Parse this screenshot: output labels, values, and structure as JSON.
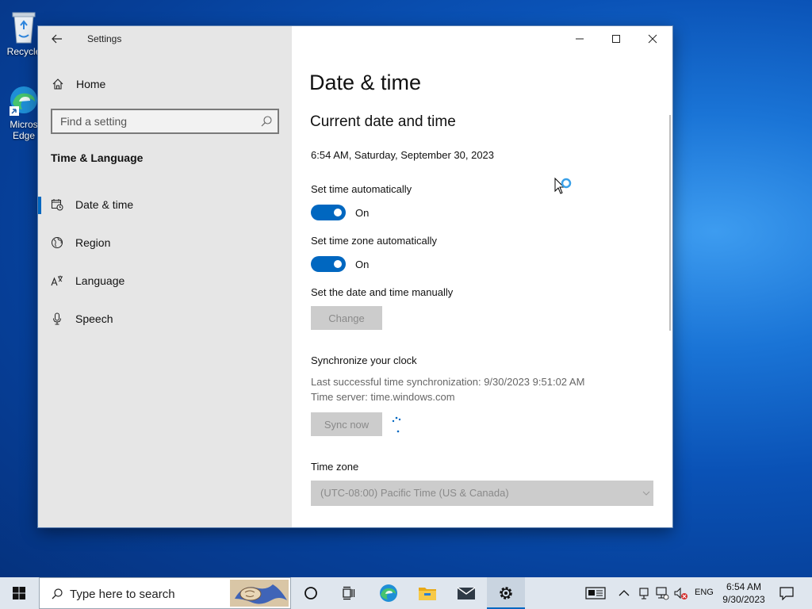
{
  "desktop": {
    "recycle_label": "Recycle",
    "edge_label_1": "Micros",
    "edge_label_2": "Edge"
  },
  "window": {
    "title": "Settings",
    "home_label": "Home",
    "search_placeholder": "Find a setting",
    "section_title": "Time & Language",
    "nav": [
      {
        "label": "Date & time",
        "icon": "calendar-clock-icon",
        "active": true
      },
      {
        "label": "Region",
        "icon": "globe-icon"
      },
      {
        "label": "Language",
        "icon": "language-icon"
      },
      {
        "label": "Speech",
        "icon": "microphone-icon"
      }
    ]
  },
  "content": {
    "page_title": "Date & time",
    "current_heading": "Current date and time",
    "current_datetime": "6:54 AM, Saturday, September 30, 2023",
    "set_time_auto_label": "Set time automatically",
    "set_time_auto_state": "On",
    "set_tz_auto_label": "Set time zone automatically",
    "set_tz_auto_state": "On",
    "manual_label": "Set the date and time manually",
    "change_button": "Change",
    "sync_heading": "Synchronize your clock",
    "last_sync": "Last successful time synchronization: 9/30/2023 9:51:02 AM",
    "time_server": "Time server: time.windows.com",
    "sync_button": "Sync now",
    "timezone_label": "Time zone",
    "timezone_value": "(UTC-08:00) Pacific Time (US & Canada)"
  },
  "taskbar": {
    "search_placeholder": "Type here to search",
    "lang": "ENG",
    "time": "6:54 AM",
    "date": "9/30/2023"
  },
  "colors": {
    "accent": "#0067c0",
    "sidebar_bg": "#e6e6e6",
    "disabled_bg": "#cccccc"
  }
}
